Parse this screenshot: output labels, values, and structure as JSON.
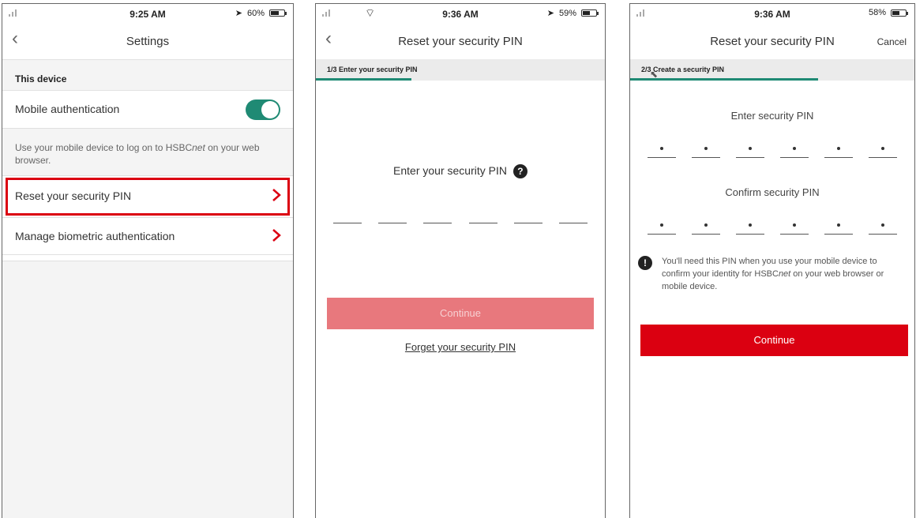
{
  "screen1": {
    "status": {
      "time": "9:25 AM",
      "battery": "60%",
      "battery_level": 0.6
    },
    "nav": {
      "title": "Settings"
    },
    "section": "This device",
    "mobile_auth": {
      "label": "Mobile authentication",
      "enabled": true
    },
    "description_prefix": "Use your mobile device to log on to HSBC",
    "description_italic": "net",
    "description_suffix": " on your web browser.",
    "items": [
      {
        "label": "Reset your security PIN"
      },
      {
        "label": "Manage biometric authentication"
      }
    ]
  },
  "screen2": {
    "status": {
      "time": "9:36 AM",
      "battery": "59%",
      "battery_level": 0.59
    },
    "nav": {
      "title": "Reset your security PIN"
    },
    "step": {
      "label": "1/3 Enter your security PIN",
      "progress": 0.33
    },
    "prompt": "Enter your security PIN",
    "help_icon": "?",
    "pin_length": 6,
    "continue_label": "Continue",
    "forgot_link": "Forget your security PIN"
  },
  "screen3": {
    "status": {
      "time": "9:36 AM",
      "battery": "58%",
      "battery_level": 0.58
    },
    "nav": {
      "title": "Reset your security PIN",
      "cancel": "Cancel"
    },
    "step": {
      "label": "2/3 Create a security PIN",
      "progress": 0.66
    },
    "enter_label": "Enter security PIN",
    "confirm_label": "Confirm security PIN",
    "info_prefix": "You'll need this PIN when you use your mobile device to confirm your identity for HSBC",
    "info_italic": "net",
    "info_suffix": " on your web browser or mobile device.",
    "info_icon": "!",
    "continue_label": "Continue"
  },
  "colors": {
    "accent": "#1f8a74",
    "brand_red": "#db0011",
    "disabled_red": "#e8787d"
  },
  "icons": [
    "back-chevron-icon",
    "chevron-right-icon",
    "help-icon",
    "info-icon",
    "signal-icon",
    "wifi-icon",
    "location-arrow-icon",
    "battery-icon",
    "mouse-cursor-icon"
  ]
}
